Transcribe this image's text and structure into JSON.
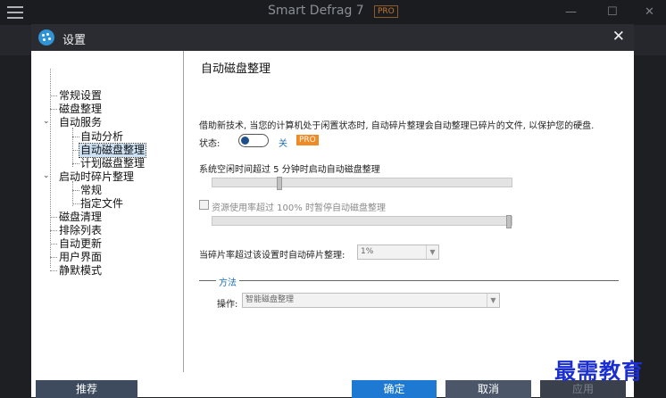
{
  "app": {
    "title": "Smart Defrag 7",
    "pro_mark": "PRO"
  },
  "dialog": {
    "title": "设置",
    "tree": [
      {
        "label": "常规设置",
        "level": 0
      },
      {
        "label": "磁盘整理",
        "level": 0
      },
      {
        "label": "自动服务",
        "level": 0,
        "expanded": true
      },
      {
        "label": "自动分析",
        "level": 1
      },
      {
        "label": "自动磁盘整理",
        "level": 1,
        "selected": true
      },
      {
        "label": "计划磁盘整理",
        "level": 1
      },
      {
        "label": "启动时碎片整理",
        "level": 0,
        "expanded": true
      },
      {
        "label": "常规",
        "level": 1
      },
      {
        "label": "指定文件",
        "level": 1
      },
      {
        "label": "磁盘清理",
        "level": 0
      },
      {
        "label": "排除列表",
        "level": 0
      },
      {
        "label": "自动更新",
        "level": 0
      },
      {
        "label": "用户界面",
        "level": 0
      },
      {
        "label": "静默模式",
        "level": 0
      }
    ],
    "panel": {
      "title": "自动磁盘整理",
      "description": "借助新技术, 当您的计算机处于闲置状态时, 自动碎片整理会自动整理已碎片的文件, 以保护您的硬盘.",
      "status_label": "状态:",
      "toggle_state": "关",
      "pro_badge": "PRO",
      "idle_label": "系统空闲时间超过 5 分钟时启动自动磁盘整理",
      "idle_slider_level": 0.22,
      "resource_label": "资源使用率超过 100% 时暂停自动磁盘整理",
      "resource_slider_level": 1.0,
      "frag_label": "当碎片率超过该设置时自动碎片整理:",
      "frag_value": "1%",
      "method_title": "方法",
      "operation_label": "操作:",
      "operation_value": "智能磁盘整理"
    },
    "buttons": {
      "recommend": "推荐",
      "ok": "确定",
      "cancel": "取消",
      "apply": "应用"
    }
  },
  "watermark": "最需教育"
}
